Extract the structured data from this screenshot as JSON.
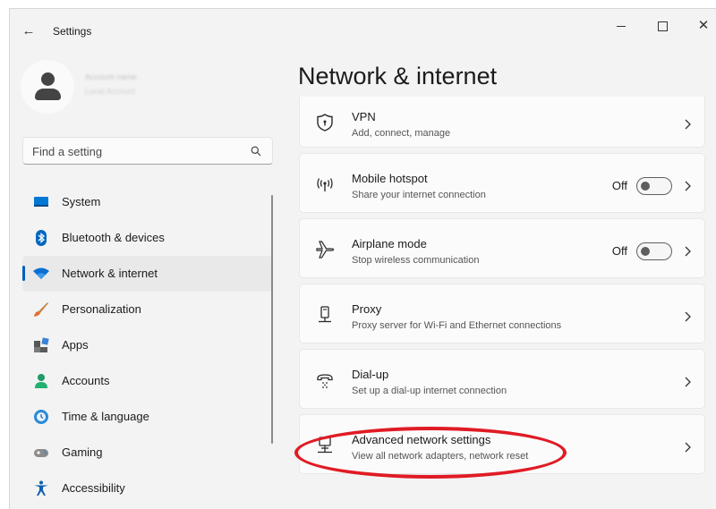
{
  "window": {
    "app_title": "Settings"
  },
  "profile": {
    "name": "Account name",
    "subtitle": "Local Account"
  },
  "search": {
    "placeholder": "Find a setting"
  },
  "nav": {
    "items": [
      {
        "label": "System",
        "icon": "system-icon"
      },
      {
        "label": "Bluetooth & devices",
        "icon": "bluetooth-icon"
      },
      {
        "label": "Network & internet",
        "icon": "wifi-icon",
        "selected": true
      },
      {
        "label": "Personalization",
        "icon": "brush-icon"
      },
      {
        "label": "Apps",
        "icon": "apps-icon"
      },
      {
        "label": "Accounts",
        "icon": "person-icon"
      },
      {
        "label": "Time & language",
        "icon": "globe-clock-icon"
      },
      {
        "label": "Gaming",
        "icon": "gamepad-icon"
      },
      {
        "label": "Accessibility",
        "icon": "accessibility-icon"
      }
    ]
  },
  "page": {
    "title": "Network & internet"
  },
  "settings": [
    {
      "title": "VPN",
      "description": "Add, connect, manage",
      "icon": "shield-icon"
    },
    {
      "title": "Mobile hotspot",
      "description": "Share your internet connection",
      "icon": "hotspot-icon",
      "toggle": "Off"
    },
    {
      "title": "Airplane mode",
      "description": "Stop wireless communication",
      "icon": "airplane-icon",
      "toggle": "Off"
    },
    {
      "title": "Proxy",
      "description": "Proxy server for Wi-Fi and Ethernet connections",
      "icon": "proxy-icon"
    },
    {
      "title": "Dial-up",
      "description": "Set up a dial-up internet connection",
      "icon": "dialup-icon"
    },
    {
      "title": "Advanced network settings",
      "description": "View all network adapters, network reset",
      "icon": "network-pc-icon"
    }
  ],
  "colors": {
    "accent": "#005fb8",
    "annotation": "#e01b24"
  }
}
